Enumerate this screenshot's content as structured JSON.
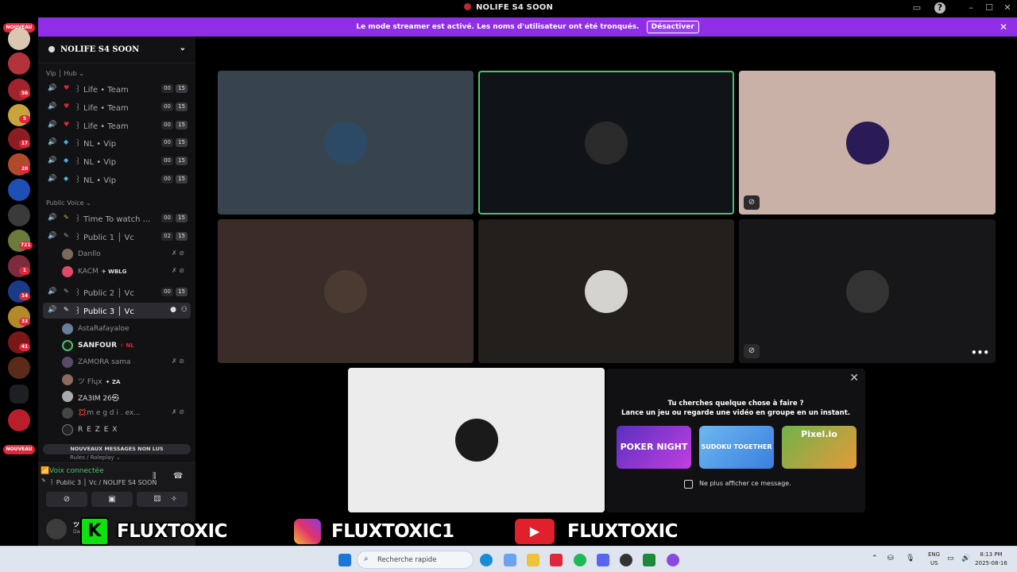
{
  "window": {
    "title": "NOLIFE S4 SOON"
  },
  "banner": {
    "text": "Le mode streamer est activé. Les noms d'utilisateur ont été tronqués.",
    "button": "Désactiver"
  },
  "rail": {
    "nouveau_top": "NOUVEAU",
    "nouveau_bottom": "NOUVEAU",
    "badges": [
      "56",
      "5",
      "17",
      "20",
      "721",
      "1",
      "14",
      "33",
      "41"
    ]
  },
  "guild": {
    "name": "NOLIFE S4 SOON"
  },
  "sidebar": {
    "cat_vip": "Vip │ Hub ⌄",
    "cat_public": "Public Voice ⌄",
    "cat_rules": "Rules / Roleplay ⌄",
    "channels": [
      {
        "emoji": "♥",
        "name": "꒱ Life • Team",
        "c1": "00",
        "c2": "15"
      },
      {
        "emoji": "♥",
        "name": "꒱ Life • Team",
        "c1": "00",
        "c2": "15"
      },
      {
        "emoji": "♥",
        "name": "꒱ Life • Team",
        "c1": "00",
        "c2": "15"
      },
      {
        "emoji": "◆",
        "name": "꒱ NL • Vip",
        "c1": "00",
        "c2": "15"
      },
      {
        "emoji": "◆",
        "name": "꒱ NL • Vip",
        "c1": "00",
        "c2": "15"
      },
      {
        "emoji": "◆",
        "name": "꒱ NL • Vip",
        "c1": "00",
        "c2": "15"
      },
      {
        "emoji": "✎",
        "name": "꒱ Time To watch ...",
        "c1": "00",
        "c2": "15"
      },
      {
        "emoji": "✎",
        "name": "꒱ Public 1 │ Vc",
        "c1": "02",
        "c2": "15"
      },
      {
        "emoji": "✎",
        "name": "꒱ Public 2 │ Vc",
        "c1": "00",
        "c2": "15"
      },
      {
        "emoji": "✎",
        "name": "꒱ Public 3 │ Vc",
        "c1": "",
        "c2": ""
      }
    ],
    "members_public1": [
      {
        "name": "Danllo",
        "tag": ""
      },
      {
        "name": "KACM",
        "tag": "✈ WBLG"
      }
    ],
    "members_public3": [
      {
        "name": "AstaRafayaloe",
        "tag": ""
      },
      {
        "name": "SANFOUR",
        "tag": "⚡ NL"
      },
      {
        "name": "ZAMORA sama",
        "tag": ""
      },
      {
        "name": "ツ Flųx",
        "tag": "✦ ZA"
      },
      {
        "name": "ZA3IM 26㉿",
        "tag": ""
      },
      {
        "name": "💢m e g d i . ex...",
        "tag": ""
      },
      {
        "name": "R E Z E X",
        "tag": ""
      }
    ],
    "new_messages": "NOUVEAUX MESSAGES NON LUS"
  },
  "voice": {
    "status": "Voix connectée",
    "channel": "꒱ Public 3 │ Vc / NOLIFE S4 SOON"
  },
  "user": {
    "name": "ツ Flųx",
    "status": "Dans un salon"
  },
  "promo": {
    "line1": "Tu cherches quelque chose à faire ?",
    "line2": "Lance un jeu ou regarde une vidéo en groupe en un instant.",
    "games": [
      "POKER NIGHT",
      "SUDOKU TOGETHER",
      "Pixel.io"
    ],
    "checkbox": "Ne plus afficher ce message."
  },
  "overlay": {
    "tiktok": "FLUXTOXIC",
    "instagram": "FLUXTOXIC1",
    "youtube": "FLUXTOXIC"
  },
  "taskbar": {
    "search": "Recherche rapide",
    "lang1": "ENG",
    "lang2": "US",
    "time": "8:13 PM",
    "date": "2025-08-16"
  },
  "colors": {
    "banner": "#8f2ee6",
    "speaking": "#4cc16a",
    "badge": "#e0263b"
  }
}
